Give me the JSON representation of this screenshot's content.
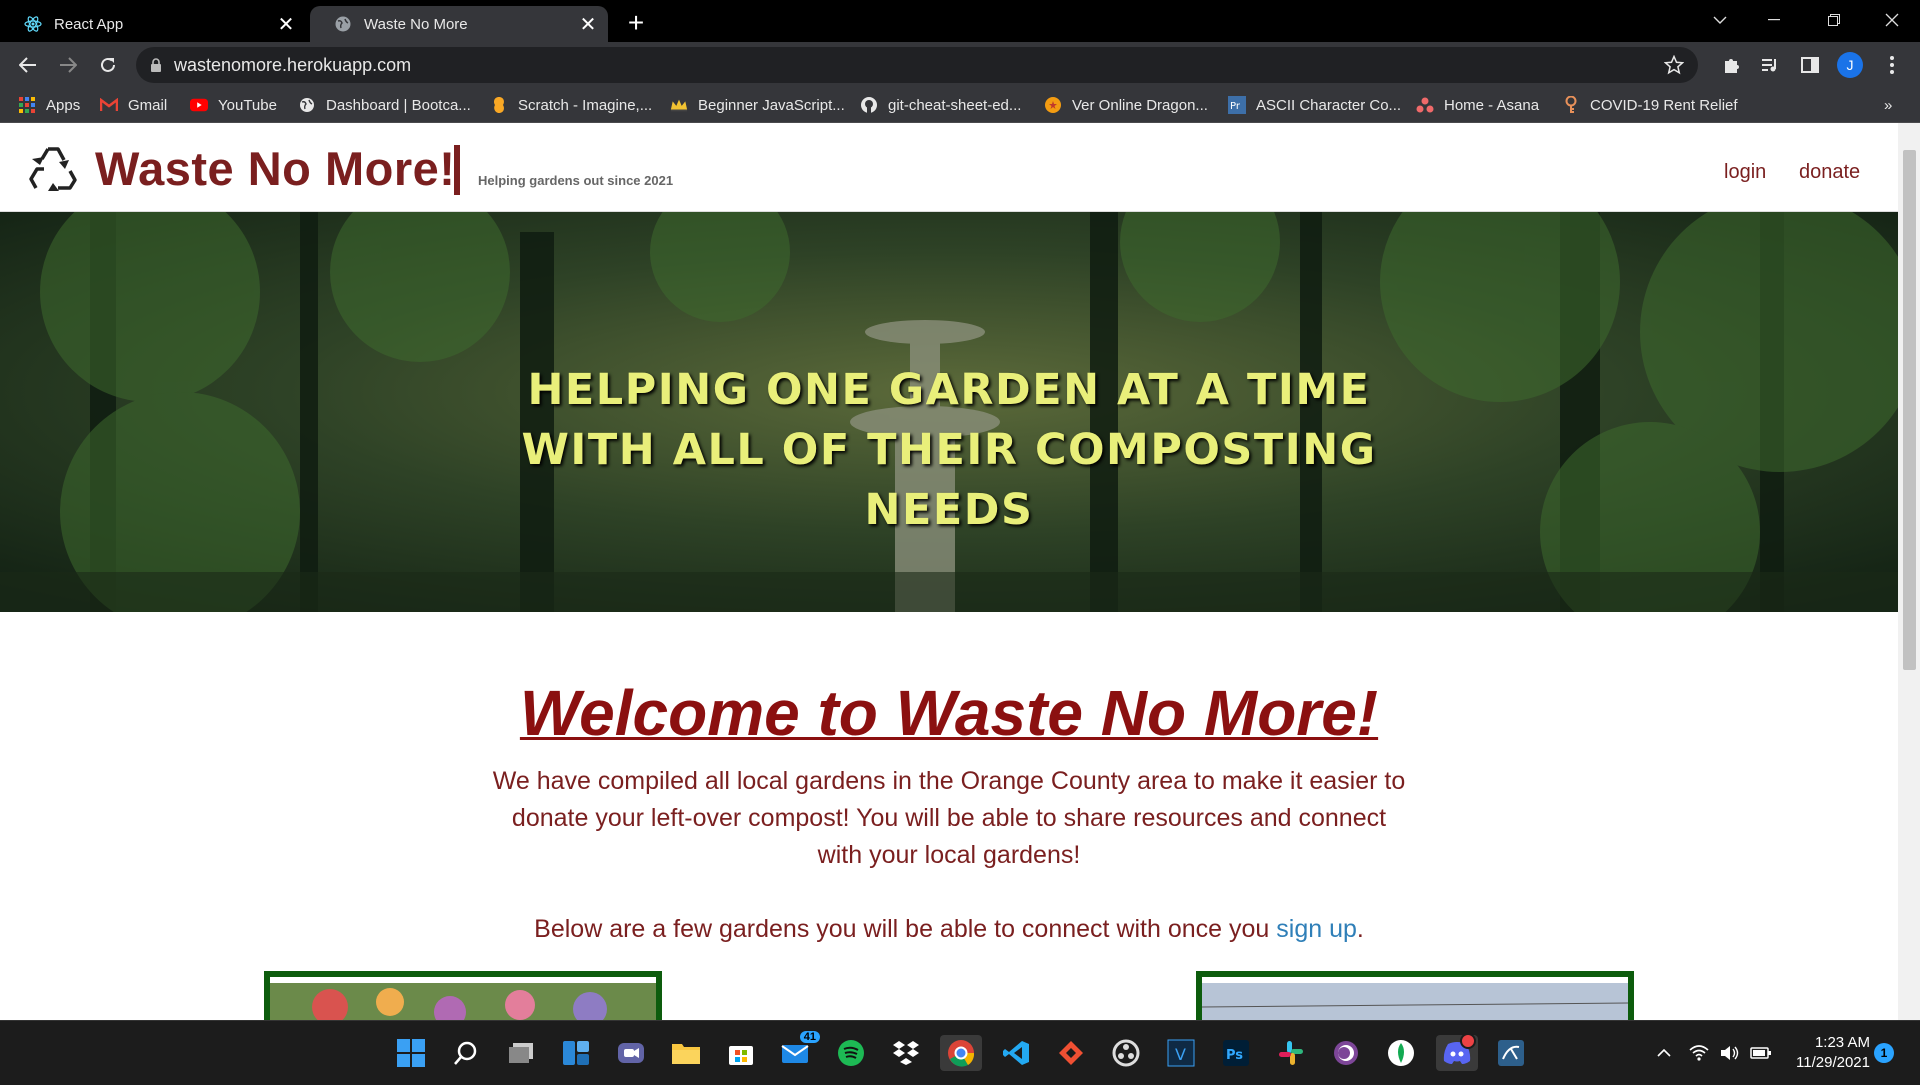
{
  "browser": {
    "tabs": [
      {
        "title": "React App",
        "active": false
      },
      {
        "title": "Waste No More",
        "active": true
      }
    ],
    "url": "wastenomore.herokuapp.com",
    "bookmarks": [
      {
        "label": "Apps",
        "icon": "apps-grid-icon"
      },
      {
        "label": "Gmail",
        "icon": "gmail-icon"
      },
      {
        "label": "YouTube",
        "icon": "youtube-icon"
      },
      {
        "label": "Dashboard | Bootca...",
        "icon": "globe-icon"
      },
      {
        "label": "Scratch - Imagine,...",
        "icon": "scratch-icon"
      },
      {
        "label": "Beginner JavaScript...",
        "icon": "crown-icon"
      },
      {
        "label": "git-cheat-sheet-ed...",
        "icon": "github-icon"
      },
      {
        "label": "Ver Online Dragon...",
        "icon": "dragon-ball-icon"
      },
      {
        "label": "ASCII Character Co...",
        "icon": "ascii-icon"
      },
      {
        "label": "Home - Asana",
        "icon": "asana-icon"
      },
      {
        "label": "COVID-19 Rent Relief",
        "icon": "key-icon"
      }
    ],
    "profile_initial": "J"
  },
  "site": {
    "brand": "Waste No More!",
    "tagline": "Helping gardens out since 2021",
    "nav": {
      "login": "login",
      "donate": "donate"
    },
    "hero_text": "HELPING ONE GARDEN AT A TIME WITH ALL OF THEIR COMPOSTING NEEDS",
    "welcome_title": "Welcome to Waste No More!",
    "intro": "We have compiled all local gardens in the Orange County area to make it easier to donate your left-over compost! You will be able to share resources and connect with your local gardens!",
    "below_prefix": "Below are a few gardens you will be able to connect with once you ",
    "signup_link": "sign up",
    "below_suffix": ".",
    "colors": {
      "brand": "#7a1f1f",
      "heading": "#8b1010",
      "hero_text": "#e9ef7a",
      "card_border": "#0d5c0d",
      "link": "#2f7fb8"
    }
  },
  "taskbar": {
    "mail_badge": "41",
    "time": "1:23 AM",
    "date": "11/29/2021",
    "notification_count": "1"
  }
}
